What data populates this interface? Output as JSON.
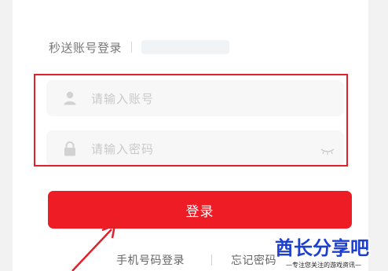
{
  "tabs": {
    "active_label": "秒送账号登录"
  },
  "form": {
    "username_placeholder": "请输入账号",
    "password_placeholder": "请输入密码"
  },
  "actions": {
    "login_label": "登录",
    "phone_login_label": "手机号码登录",
    "forgot_password_label": "忘记密码"
  },
  "watermark": {
    "title": "酋长分享吧",
    "subtitle": "—专注您关注的游戏资讯—"
  },
  "icons": {
    "user": "user-icon",
    "lock": "lock-icon",
    "eye": "eye-closed-icon"
  },
  "colors": {
    "accent": "#ee1c25",
    "highlight_border": "#e0202a",
    "watermark_blue": "#1d3fd0"
  }
}
